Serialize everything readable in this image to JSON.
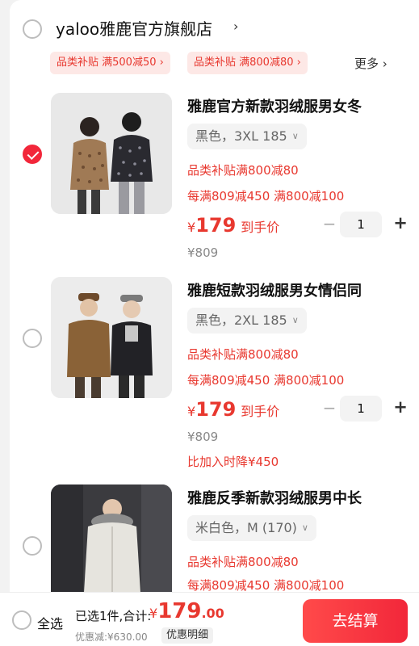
{
  "store": {
    "name": "yaloo雅鹿官方旗舰店",
    "chevron": "›",
    "coupons": [
      "品类补贴  满500减50 ›",
      "品类补贴  满800减80 ›"
    ],
    "more": "更多  ›"
  },
  "items": [
    {
      "checked": true,
      "title": "雅鹿官方新款羽绒服男女冬",
      "sku": "黑色，3XL 185",
      "promo1": "品类补贴满800减80",
      "promo2": "每满809减450  满800减100",
      "price_symbol": "¥",
      "price": "179",
      "price_tag": "到手价",
      "original_price": "¥809",
      "quantity": "1",
      "drop_text": ""
    },
    {
      "checked": false,
      "title": "雅鹿短款羽绒服男女情侣同",
      "sku": "黑色，2XL 185",
      "promo1": "品类补贴满800减80",
      "promo2": "每满809减450  满800减100",
      "price_symbol": "¥",
      "price": "179",
      "price_tag": "到手价",
      "original_price": "¥809",
      "quantity": "1",
      "drop_text": "比加入时降¥450"
    },
    {
      "checked": false,
      "title": "雅鹿反季新款羽绒服男中长",
      "sku": "米白色，M (170)",
      "promo1": "品类补贴满800减80",
      "promo2": "每满809减450  满800减100"
    }
  ],
  "stepper": {
    "minus": "−",
    "plus": "+"
  },
  "bottom": {
    "select_all": "全选",
    "summary": "已选1件,合计:",
    "total_symbol": "¥",
    "total_int": "179",
    "total_dec": ".00",
    "discount": "优惠减:¥630.00",
    "detail_button": "优惠明细",
    "checkout_button": "去结算"
  },
  "colors": {
    "accent": "#f2273a",
    "promo_text": "#e8382f",
    "coupon_bg": "#fde8e6"
  }
}
